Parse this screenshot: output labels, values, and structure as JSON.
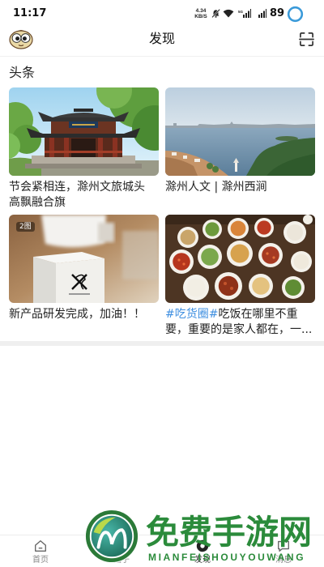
{
  "status_bar": {
    "time": "11:17",
    "net_speed": "4.34",
    "net_speed_unit": "KB/S",
    "battery": "89",
    "icons": [
      "mute-icon",
      "wifi-icon",
      "signal-icon",
      "signal-icon",
      "battery-ring-icon"
    ]
  },
  "header": {
    "title": "发现",
    "left_icon": "avatar",
    "right_icon": "scan-icon"
  },
  "section": {
    "title": "头条"
  },
  "cards": [
    {
      "lines": [
        "节会紧相连，滁州文旅城头",
        "高飘融合旗"
      ]
    },
    {
      "lines": [
        "滁州人文 | 滁州西涧"
      ]
    },
    {
      "badge": "2图",
      "lines": [
        "新产品研发完成，加油！！"
      ]
    },
    {
      "tag": "#吃货圈#",
      "lines": [
        "吃饭在哪里不重",
        "要，重要的是家人都在，一..."
      ]
    }
  ],
  "tab_bar": {
    "items": [
      {
        "label": "首页",
        "icon": "home-icon"
      },
      {
        "label": "圈子",
        "icon": "circle-icon"
      },
      {
        "label": "发现",
        "icon": "discover-icon",
        "active": true
      },
      {
        "label": "消息",
        "icon": "message-icon"
      }
    ]
  },
  "watermark": {
    "title": "免费手游网",
    "subtitle": "MIANFEISHOUYOUWANG"
  },
  "colors": {
    "text": "#222222",
    "hashtag": "#3f8fe0",
    "divider": "#efefef",
    "status_ring": "#3a9ad9",
    "watermark": "#2b8b3b"
  }
}
